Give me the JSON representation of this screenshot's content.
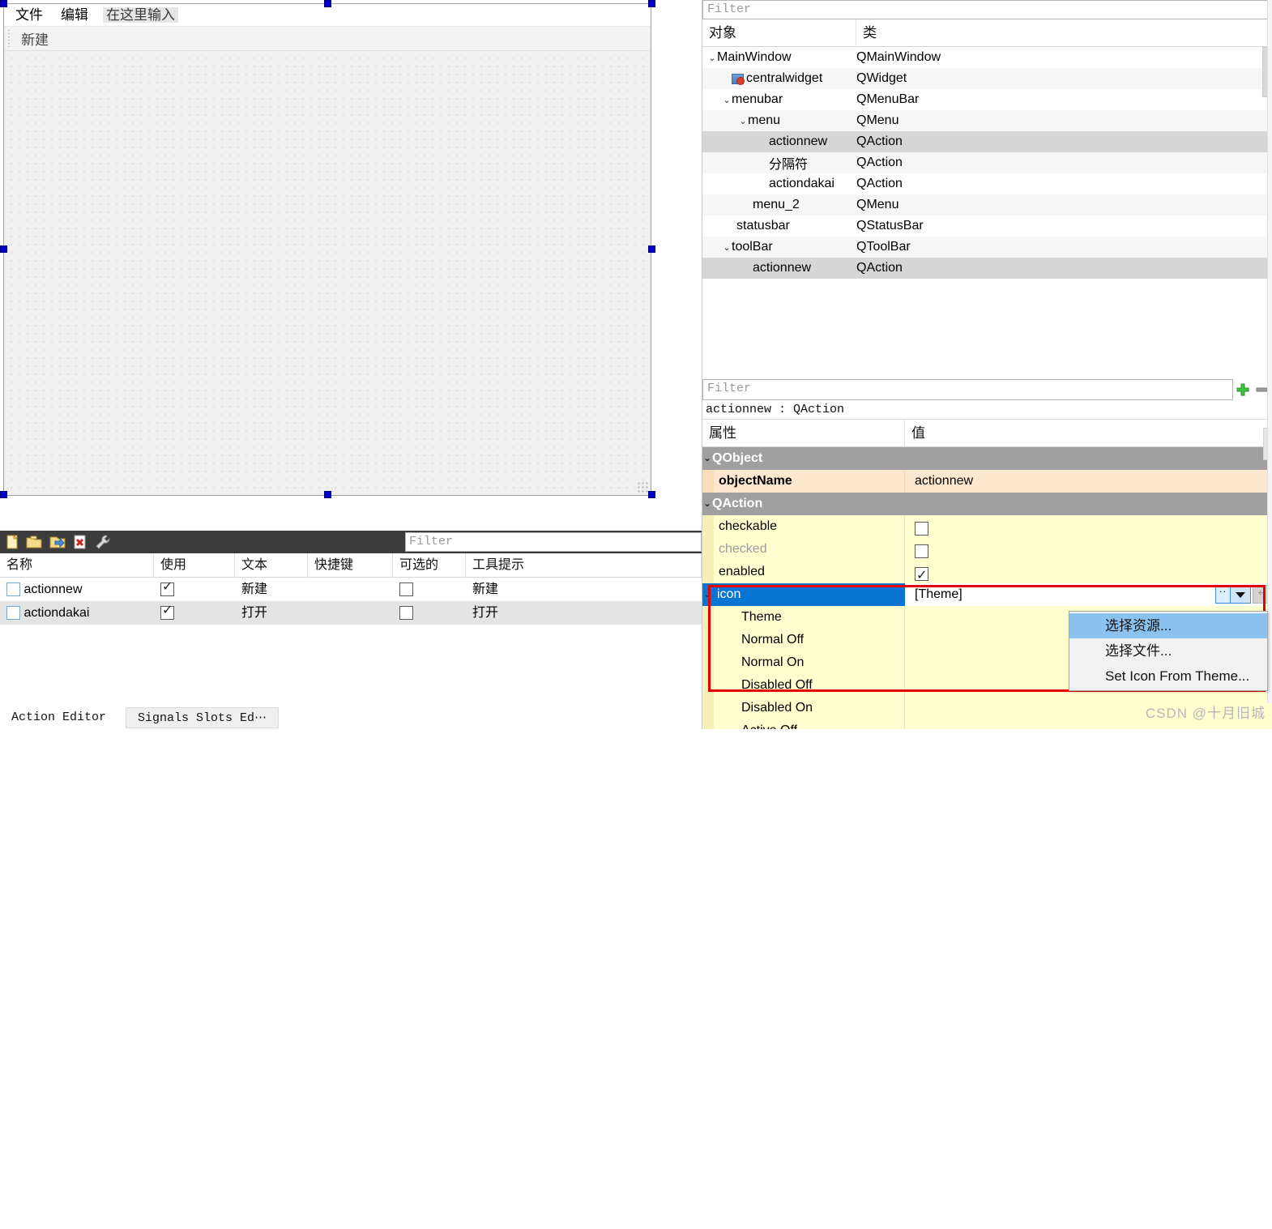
{
  "design": {
    "menubar": [
      {
        "label": "文件",
        "placeholder": false
      },
      {
        "label": "编辑",
        "placeholder": false
      },
      {
        "label": "在这里输入",
        "placeholder": true
      }
    ],
    "toolbar_items": [
      {
        "label": "新建"
      }
    ]
  },
  "action_editor": {
    "title": "Action Editor",
    "filter_placeholder": "Filter",
    "toolbar_icons": [
      "new-action-icon",
      "open-folder-icon",
      "edit-action-icon",
      "delete-action-icon",
      "wrench-icon"
    ],
    "columns": [
      "名称",
      "使用",
      "文本",
      "快捷键",
      "可选的",
      "工具提示"
    ],
    "rows": [
      {
        "name": "actionnew",
        "used": true,
        "text": "新建",
        "shortcut": "",
        "checkable": false,
        "tooltip": "新建"
      },
      {
        "name": "actiondakai",
        "used": true,
        "text": "打开",
        "shortcut": "",
        "checkable": false,
        "tooltip": "打开"
      }
    ]
  },
  "bottom_tabs": [
    {
      "label": "Action Editor",
      "active": true
    },
    {
      "label": "Signals Slots Ed⋯",
      "active": false
    }
  ],
  "object_inspector": {
    "filter_placeholder": "Filter",
    "columns": [
      "对象",
      "类"
    ],
    "rows": [
      {
        "object": "MainWindow",
        "class": "QMainWindow",
        "indent": 0,
        "expander": "down",
        "icon": null,
        "selected": false,
        "alt": false
      },
      {
        "object": "centralwidget",
        "class": "QWidget",
        "indent": 1,
        "expander": "none",
        "icon": "widget-icon",
        "selected": false,
        "alt": true
      },
      {
        "object": "menubar",
        "class": "QMenuBar",
        "indent": 1,
        "expander": "down",
        "icon": null,
        "selected": false,
        "alt": false
      },
      {
        "object": "menu",
        "class": "QMenu",
        "indent": 2,
        "expander": "down",
        "icon": null,
        "selected": false,
        "alt": true
      },
      {
        "object": "actionnew",
        "class": "QAction",
        "indent": 3,
        "expander": "none",
        "icon": null,
        "selected": true,
        "alt": false
      },
      {
        "object": "分隔符",
        "class": "QAction",
        "indent": 3,
        "expander": "none",
        "icon": null,
        "selected": false,
        "alt": true
      },
      {
        "object": "actiondakai",
        "class": "QAction",
        "indent": 3,
        "expander": "none",
        "icon": null,
        "selected": false,
        "alt": false
      },
      {
        "object": "menu_2",
        "class": "QMenu",
        "indent": 2,
        "expander": "none",
        "icon": null,
        "selected": false,
        "alt": true
      },
      {
        "object": "statusbar",
        "class": "QStatusBar",
        "indent": 1,
        "expander": "none",
        "icon": null,
        "selected": false,
        "alt": false
      },
      {
        "object": "toolBar",
        "class": "QToolBar",
        "indent": 1,
        "expander": "down",
        "icon": null,
        "selected": false,
        "alt": true
      },
      {
        "object": "actionnew",
        "class": "QAction",
        "indent": 2,
        "expander": "none",
        "icon": null,
        "selected": true,
        "alt": false
      }
    ]
  },
  "property_editor": {
    "filter_placeholder": "Filter",
    "add_button": "add-property-icon",
    "remove_button": "remove-property-icon",
    "object_line": "actionnew : QAction",
    "columns": [
      "属性",
      "值"
    ],
    "rows": [
      {
        "kind": "group",
        "name": "QObject",
        "value": "",
        "expander": "down"
      },
      {
        "kind": "prop",
        "name": "objectName",
        "value": "actionnew",
        "style": "peach",
        "bold": true
      },
      {
        "kind": "group",
        "name": "QAction",
        "value": "",
        "expander": "down"
      },
      {
        "kind": "check",
        "name": "checkable",
        "checked": false
      },
      {
        "kind": "check",
        "name": "checked",
        "checked": false,
        "disabled": true
      },
      {
        "kind": "check",
        "name": "enabled",
        "checked": true
      },
      {
        "kind": "icon",
        "name": "icon",
        "value": "[Theme]",
        "selected": true,
        "expander": "down"
      },
      {
        "kind": "sub",
        "name": "Theme",
        "value": ""
      },
      {
        "kind": "sub",
        "name": "Normal Off",
        "value": ""
      },
      {
        "kind": "sub",
        "name": "Normal On",
        "value": ""
      },
      {
        "kind": "sub",
        "name": "Disabled Off",
        "value": ""
      },
      {
        "kind": "sub",
        "name": "Disabled On",
        "value": ""
      },
      {
        "kind": "sub",
        "name": "Active Off",
        "value": ""
      }
    ]
  },
  "context_menu": {
    "items": [
      {
        "label": "选择资源...",
        "highlighted": true
      },
      {
        "label": "选择文件...",
        "highlighted": false
      },
      {
        "label": "Set Icon From Theme...",
        "highlighted": false
      }
    ]
  },
  "watermark": "CSDN @十月旧城"
}
